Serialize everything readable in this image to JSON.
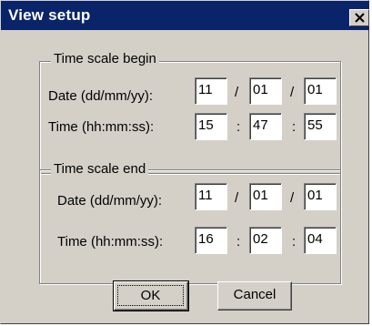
{
  "window": {
    "title": "View setup",
    "close_icon": "close-icon"
  },
  "begin": {
    "legend": "Time scale begin",
    "date_label": "Date (dd/mm/yy):",
    "time_label": "Time (hh:mm:ss):",
    "date": [
      "11",
      "01",
      "01"
    ],
    "time": [
      "15",
      "47",
      "55"
    ],
    "date_sep": "/",
    "time_sep": ":"
  },
  "end": {
    "legend": "Time scale end",
    "date_label": "Date (dd/mm/yy):",
    "time_label": "Time (hh:mm:ss):",
    "date": [
      "11",
      "01",
      "01"
    ],
    "time": [
      "16",
      "02",
      "04"
    ],
    "date_sep": "/",
    "time_sep": ":"
  },
  "buttons": {
    "ok": "OK",
    "cancel": "Cancel"
  }
}
